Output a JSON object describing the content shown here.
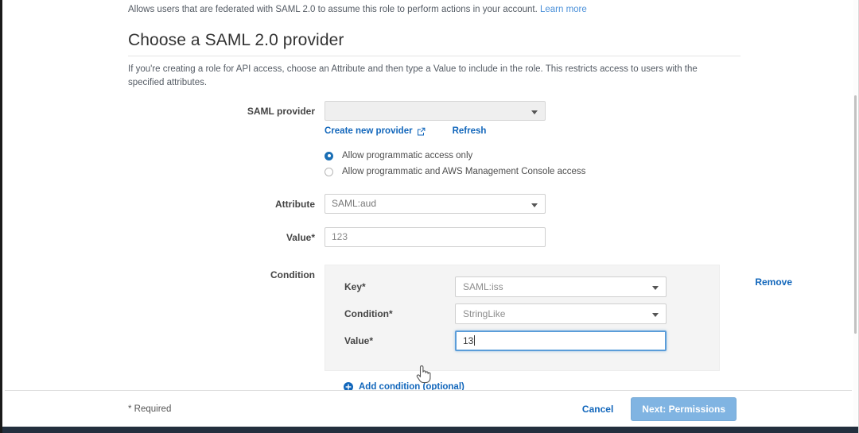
{
  "page": {
    "intro_text": "Allows users that are federated with SAML 2.0 to assume this role to perform actions in your account.",
    "intro_link": "Learn more",
    "title": "Choose a SAML 2.0 provider",
    "description": "If you're creating a role for API access, choose an Attribute and then type a Value to include in the role. This restricts access to users with the specified attributes."
  },
  "form": {
    "saml_provider": {
      "label": "SAML provider",
      "value": "",
      "placeholder": ""
    },
    "links": {
      "create_new_provider": "Create new provider",
      "refresh": "Refresh"
    },
    "access_options": [
      {
        "label": "Allow programmatic access only",
        "selected": true
      },
      {
        "label": "Allow programmatic and AWS Management Console access",
        "selected": false
      }
    ],
    "attribute": {
      "label": "Attribute",
      "value": "SAML:aud"
    },
    "value": {
      "label": "Value*",
      "value": "123"
    },
    "condition": {
      "label": "Condition",
      "key": {
        "label": "Key*",
        "value": "SAML:iss"
      },
      "operator": {
        "label": "Condition*",
        "value": "StringLike"
      },
      "value": {
        "label": "Value*",
        "value": "13"
      },
      "remove_label": "Remove",
      "add_label": "Add condition (optional)"
    }
  },
  "footer": {
    "required_note": "* Required",
    "cancel": "Cancel",
    "next": "Next: Permissions"
  },
  "colors": {
    "link_blue": "#1166bb",
    "radio_blue": "#1a6fb5",
    "primary_button": "#80b4e2",
    "focus_border": "#5b9dd9",
    "panel_bg": "#f4f4f4",
    "footer_bar": "#232f3e"
  }
}
